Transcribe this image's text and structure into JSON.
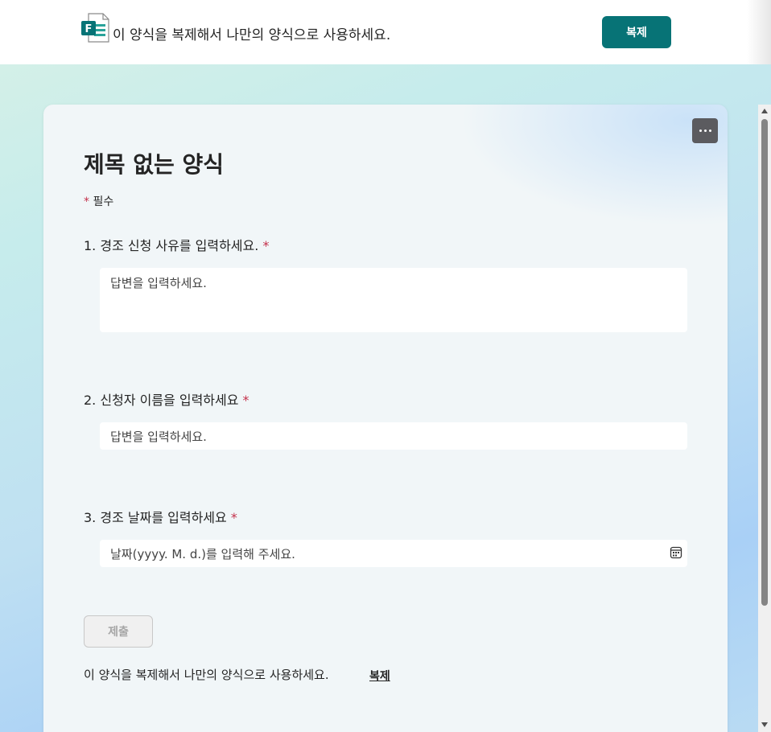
{
  "banner": {
    "text": "이 양식을 복제해서 나만의 양식으로 사용하세요.",
    "copy_label": "복제"
  },
  "form": {
    "title": "제목 없는 양식",
    "required_star": "*",
    "required_label": "필수",
    "questions": [
      {
        "label": "1. 경조 신청 사유를 입력하세요.",
        "star": "*",
        "placeholder": "답변을 입력하세요."
      },
      {
        "label": "2. 신청자 이름을 입력하세요",
        "star": "*",
        "placeholder": "답변을 입력하세요."
      },
      {
        "label": "3. 경조 날짜를 입력하세요",
        "star": "*",
        "placeholder": "날짜(yyyy. M. d.)를 입력해 주세요."
      }
    ],
    "submit_label": "제출"
  },
  "footer": {
    "text": "이 양식을 복제해서 나만의 양식으로 사용하세요.",
    "link_label": "복제"
  },
  "colors": {
    "accent": "#077376",
    "required": "#c4314b"
  }
}
